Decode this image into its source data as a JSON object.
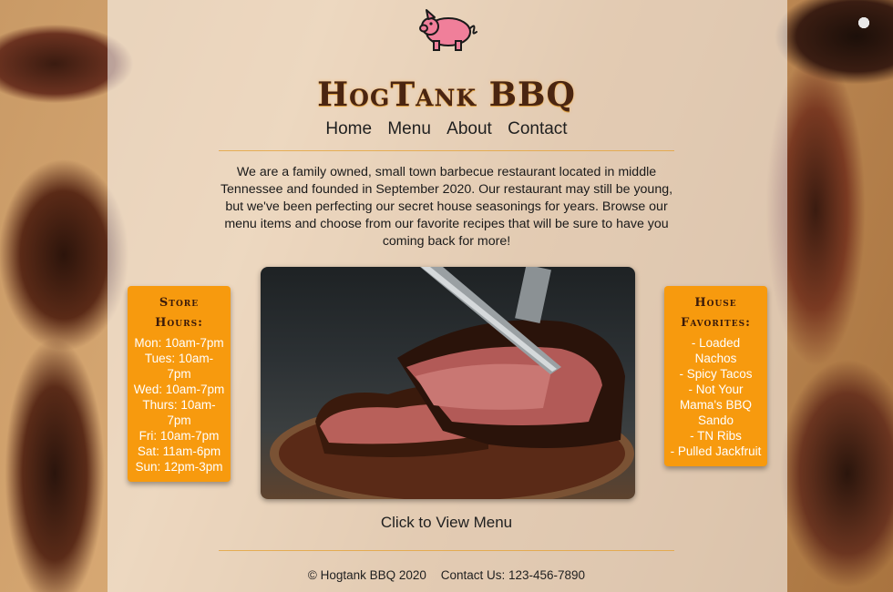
{
  "site": {
    "title": "HogTank BBQ"
  },
  "nav": {
    "items": [
      "Home",
      "Menu",
      "About",
      "Contact"
    ]
  },
  "intro_text": "We are a family owned, small town barbecue restaurant located in middle Tennessee and founded in September 2020. Our restaurant may still be young, but we've been perfecting our secret house seasonings for years. Browse our menu items and choose from our favorite recipes that will be sure to have you coming back for more!",
  "hours": {
    "heading": "Store Hours:",
    "lines": [
      "Mon: 10am-7pm",
      "Tues: 10am-7pm",
      "Wed: 10am-7pm",
      "Thurs: 10am-7pm",
      "Fri: 10am-7pm",
      "Sat: 11am-6pm",
      "Sun: 12pm-3pm"
    ]
  },
  "favorites": {
    "heading": "House Favorites:",
    "items": [
      "- Loaded Nachos",
      "- Spicy Tacos",
      "- Not Your Mama's BBQ Sando",
      "- TN Ribs",
      "- Pulled Jackfruit"
    ]
  },
  "cta_label": "Click to View Menu",
  "footer": {
    "copyright": "© Hogtank BBQ 2020",
    "contact": "Contact Us:  123-456-7890"
  },
  "colors": {
    "accent": "#f79a0e",
    "title": "#4a2511",
    "pig": "#f07f9a"
  },
  "icons": {
    "logo": "pig-icon"
  }
}
